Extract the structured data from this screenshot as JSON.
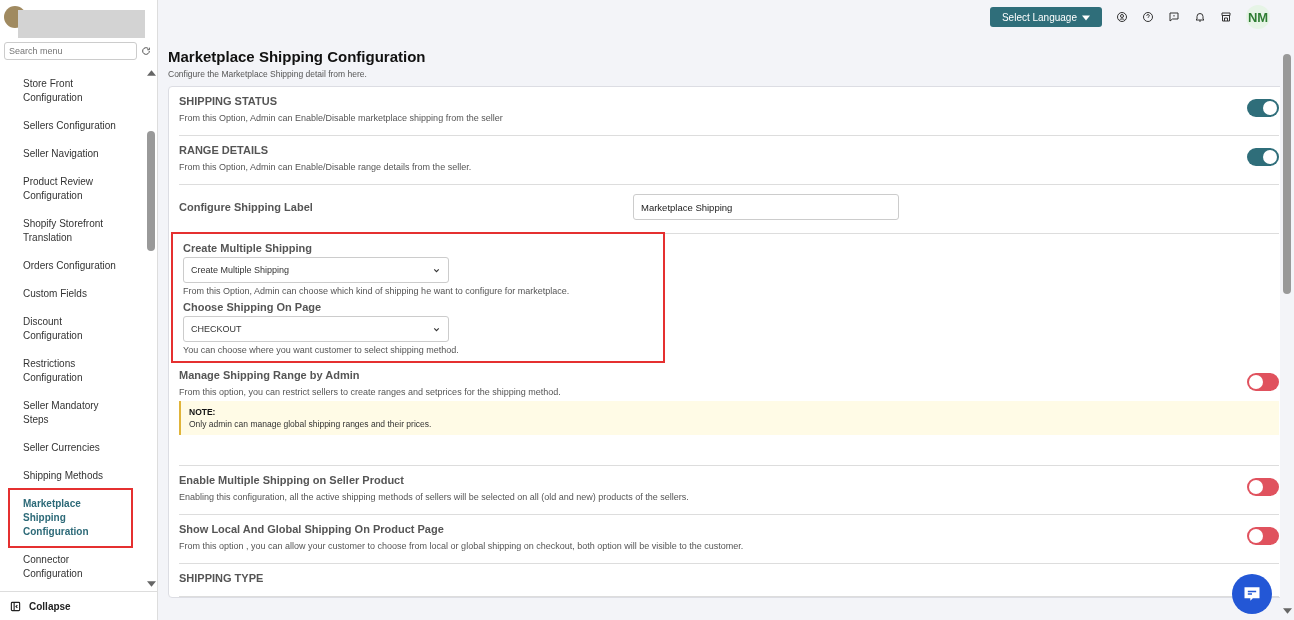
{
  "sidebar": {
    "search": {
      "placeholder": "Search menu"
    },
    "items": [
      {
        "label": "Store Front Configuration",
        "selected": false,
        "highlighted": false
      },
      {
        "label": "Sellers Configuration",
        "selected": false,
        "highlighted": false
      },
      {
        "label": "Seller Navigation",
        "selected": false,
        "highlighted": false
      },
      {
        "label": "Product Review Configuration",
        "selected": false,
        "highlighted": false
      },
      {
        "label": "Shopify Storefront Translation",
        "selected": false,
        "highlighted": false
      },
      {
        "label": "Orders Configuration",
        "selected": false,
        "highlighted": false
      },
      {
        "label": "Custom Fields",
        "selected": false,
        "highlighted": false
      },
      {
        "label": "Discount Configuration",
        "selected": false,
        "highlighted": false
      },
      {
        "label": "Restrictions Configuration",
        "selected": false,
        "highlighted": false
      },
      {
        "label": "Seller Mandatory Steps",
        "selected": false,
        "highlighted": false
      },
      {
        "label": "Seller Currencies",
        "selected": false,
        "highlighted": false
      },
      {
        "label": "Shipping Methods",
        "selected": false,
        "highlighted": false
      },
      {
        "label": "Marketplace Shipping Configuration",
        "selected": true,
        "highlighted": true
      },
      {
        "label": "Connector Configuration",
        "selected": false,
        "highlighted": false
      }
    ],
    "collapse": "Collapse"
  },
  "topbar": {
    "language_button": "Select Language",
    "avatar": "NM"
  },
  "page": {
    "title": "Marketplace Shipping Configuration",
    "subtitle": "Configure the Marketplace Shipping detail from here."
  },
  "sections": [
    {
      "kind": "toggle",
      "title": "SHIPPING STATUS",
      "description": "From this Option, Admin can Enable/Disable marketplace shipping from the seller",
      "on": true
    },
    {
      "kind": "toggle",
      "title": "RANGE DETAILS",
      "description": "From this Option, Admin can Enable/Disable range details from the seller.",
      "on": true
    },
    {
      "kind": "text",
      "title": "Configure Shipping Label",
      "value": "Marketplace Shipping"
    },
    {
      "kind": "selects",
      "highlighted": true,
      "fields": [
        {
          "title": "Create Multiple Shipping",
          "value": "Create Multiple Shipping",
          "description": "From this Option, Admin can choose which kind of shipping he want to configure for marketplace."
        },
        {
          "title": "Choose Shipping On Page",
          "value": "CHECKOUT",
          "description": "You can choose where you want customer to select shipping method."
        }
      ]
    },
    {
      "kind": "toggle",
      "title": "Manage Shipping Range by Admin",
      "description": "From this option, you can restrict sellers to create ranges and setprices for the shipping method.",
      "on": false,
      "note": {
        "heading": "NOTE:",
        "text": "Only admin can manage global shipping ranges and their prices."
      }
    },
    {
      "kind": "toggle",
      "title": "Enable Multiple Shipping on Seller Product",
      "description": "Enabling this configuration, all the active shipping methods of sellers will be selected on all (old and new) products of the sellers.",
      "on": false
    },
    {
      "kind": "toggle",
      "title": "Show Local And Global Shipping On Product Page",
      "description": "From this option , you can allow your customer to choose from local or global shipping on checkout, both option will be visible to the customer.",
      "on": false
    },
    {
      "kind": "heading",
      "title": "SHIPPING TYPE"
    }
  ]
}
